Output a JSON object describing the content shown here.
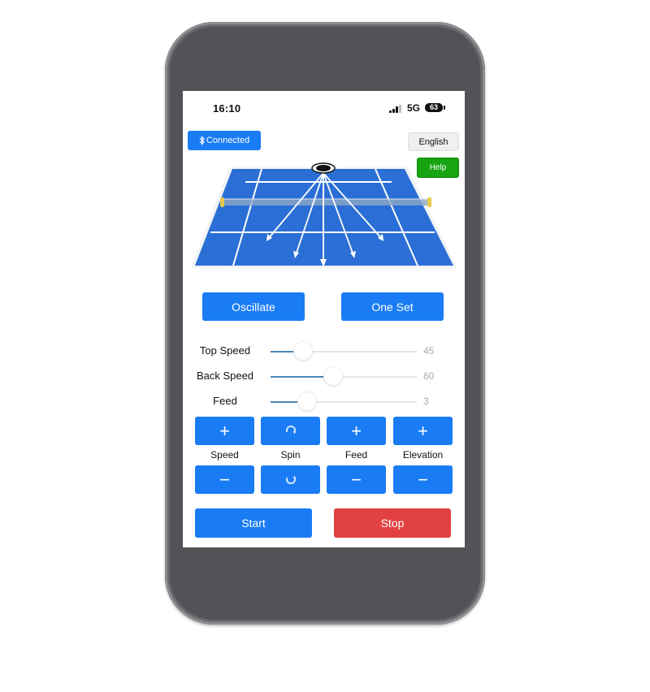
{
  "status_bar": {
    "time": "16:10",
    "network": "5G",
    "battery": "63",
    "icons": [
      "signal-icon",
      "battery-icon"
    ]
  },
  "header": {
    "connection_label": "Connected",
    "connection_icon": "bluetooth-icon",
    "language_label": "English",
    "help_label": "Help"
  },
  "court": {
    "description": "Tennis court diagram with ball machine and 5 shot direction arrows",
    "arrow_count": 5
  },
  "modes": {
    "oscillate_label": "Oscillate",
    "one_set_label": "One Set"
  },
  "sliders": [
    {
      "label": "Top Speed",
      "value": "45",
      "fraction": 0.22
    },
    {
      "label": "Back Speed",
      "value": "60",
      "fraction": 0.43
    },
    {
      "label": "Feed",
      "value": "3",
      "fraction": 0.25
    }
  ],
  "controls": [
    {
      "label": "Speed",
      "up_icon": "+",
      "down_icon": "−",
      "up_name": "plus-icon",
      "down_name": "minus-icon"
    },
    {
      "label": "Spin",
      "up_icon": "topspin",
      "down_icon": "backspin",
      "up_name": "topspin-icon",
      "down_name": "backspin-icon"
    },
    {
      "label": "Feed",
      "up_icon": "+",
      "down_icon": "−",
      "up_name": "plus-icon",
      "down_name": "minus-icon"
    },
    {
      "label": "Elevation",
      "up_icon": "+",
      "down_icon": "−",
      "up_name": "plus-icon",
      "down_name": "minus-icon"
    }
  ],
  "actions": {
    "start_label": "Start",
    "stop_label": "Stop"
  },
  "colors": {
    "primary": "#1a7cf5",
    "help": "#16a413",
    "stop": "#e24141",
    "court": "#2b6fd6",
    "phone_body": "#545256"
  }
}
